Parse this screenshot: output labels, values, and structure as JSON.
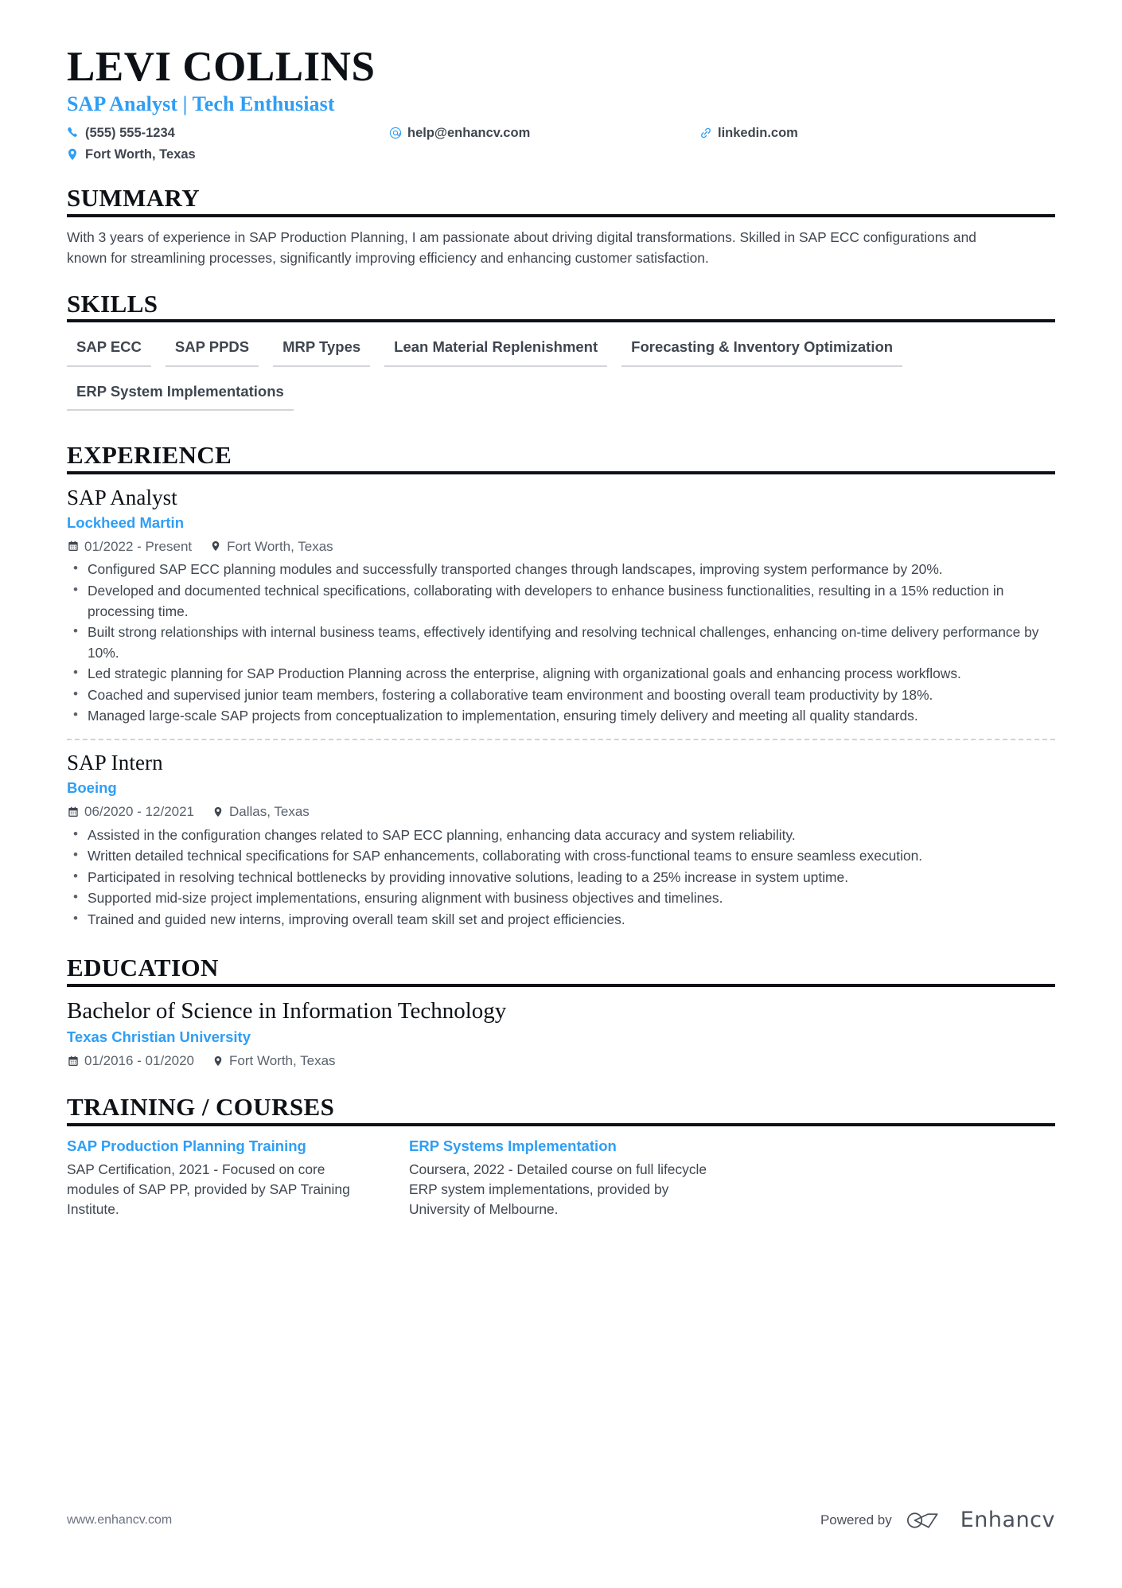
{
  "header": {
    "name": "LEVI COLLINS",
    "headline": "SAP Analyst | Tech Enthusiast",
    "contacts": [
      {
        "icon": "phone-icon",
        "text": "(555) 555-1234"
      },
      {
        "icon": "email-icon",
        "text": "help@enhancv.com"
      },
      {
        "icon": "link-icon",
        "text": "linkedin.com"
      },
      {
        "icon": "location-icon",
        "text": "Fort Worth, Texas"
      }
    ]
  },
  "summary": {
    "title": "SUMMARY",
    "text": "With 3 years of experience in SAP Production Planning, I am passionate about driving digital transformations. Skilled in SAP ECC configurations and known for streamlining processes, significantly improving efficiency and enhancing customer satisfaction."
  },
  "skills": {
    "title": "SKILLS",
    "items": [
      "SAP ECC",
      "SAP PPDS",
      "MRP Types",
      "Lean Material Replenishment",
      "Forecasting & Inventory Optimization",
      "ERP System Implementations"
    ]
  },
  "experience": {
    "title": "EXPERIENCE",
    "entries": [
      {
        "job_title": "SAP Analyst",
        "company": "Lockheed Martin",
        "dates": "01/2022 - Present",
        "location": "Fort Worth, Texas",
        "bullets": [
          "Configured SAP ECC planning modules and successfully transported changes through landscapes, improving system performance by 20%.",
          "Developed and documented technical specifications, collaborating with developers to enhance business functionalities, resulting in a 15% reduction in processing time.",
          "Built strong relationships with internal business teams, effectively identifying and resolving technical challenges, enhancing on-time delivery performance by 10%.",
          "Led strategic planning for SAP Production Planning across the enterprise, aligning with organizational goals and enhancing process workflows.",
          "Coached and supervised junior team members, fostering a collaborative team environment and boosting overall team productivity by 18%.",
          "Managed large-scale SAP projects from conceptualization to implementation, ensuring timely delivery and meeting all quality standards."
        ]
      },
      {
        "job_title": "SAP Intern",
        "company": "Boeing",
        "dates": "06/2020 - 12/2021",
        "location": "Dallas, Texas",
        "bullets": [
          "Assisted in the configuration changes related to SAP ECC planning, enhancing data accuracy and system reliability.",
          "Written detailed technical specifications for SAP enhancements, collaborating with cross-functional teams to ensure seamless execution.",
          "Participated in resolving technical bottlenecks by providing innovative solutions, leading to a 25% increase in system uptime.",
          "Supported mid-size project implementations, ensuring alignment with business objectives and timelines.",
          "Trained and guided new interns, improving overall team skill set and project efficiencies."
        ]
      }
    ]
  },
  "education": {
    "title": "EDUCATION",
    "entries": [
      {
        "degree": "Bachelor of Science in Information Technology",
        "school": "Texas Christian University",
        "dates": "01/2016 - 01/2020",
        "location": "Fort Worth, Texas"
      }
    ]
  },
  "training": {
    "title": "TRAINING / COURSES",
    "courses": [
      {
        "title": "SAP Production Planning Training",
        "description": "SAP Certification, 2021 - Focused on core modules of SAP PP, provided by SAP Training Institute."
      },
      {
        "title": "ERP Systems Implementation",
        "description": "Coursera, 2022 - Detailed course on full lifecycle ERP system implementations, provided by University of Melbourne."
      }
    ]
  },
  "footer": {
    "url": "www.enhancv.com",
    "powered_by": "Powered by",
    "brand": "Enhancv"
  },
  "colors": {
    "accent": "#2f9ef4",
    "ink": "#0d1116",
    "body": "#3f4650",
    "muted": "#5a626d",
    "rule": "#d2d5d9"
  }
}
